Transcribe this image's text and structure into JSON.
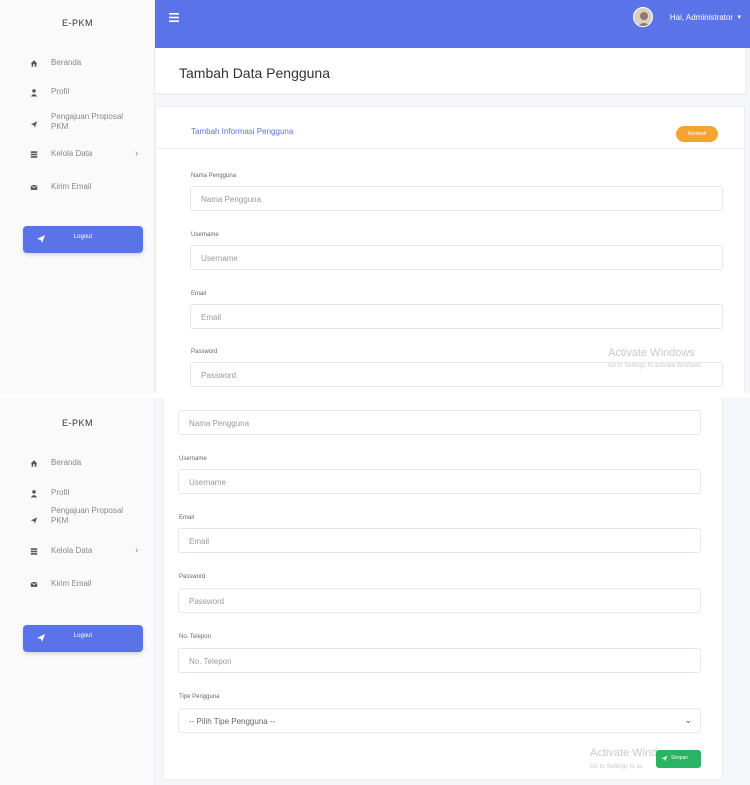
{
  "sidebar": {
    "brand": "E-PKM",
    "items": [
      {
        "label": "Beranda",
        "icon": "home-icon"
      },
      {
        "label": "Profil",
        "icon": "user-icon"
      },
      {
        "label": "Pengajuan Proposal PKM",
        "icon": "send-icon"
      },
      {
        "label": "Kelola Data",
        "icon": "list-icon",
        "has_submenu": true
      },
      {
        "label": "Kirim Email",
        "icon": "envelope-icon"
      }
    ],
    "logout_label": "Logout"
  },
  "topbar": {
    "user_label": "Hai, Administrator",
    "caret": "▾",
    "color": "#5b73e8"
  },
  "page": {
    "title": "Tambah Data Pengguna"
  },
  "form": {
    "heading": "Tambah Informasi Pengguna",
    "back_label": "Kembali",
    "submit_label": "Simpan",
    "fields": {
      "nama": {
        "label": "Nama Pengguna",
        "placeholder": "Nama Pengguna"
      },
      "username": {
        "label": "Username",
        "placeholder": "Username"
      },
      "email": {
        "label": "Email",
        "placeholder": "Email"
      },
      "password": {
        "label": "Password",
        "placeholder": "Password"
      },
      "telepon": {
        "label": "No. Telepon",
        "placeholder": "No. Telepon"
      },
      "tipe": {
        "label": "Tipe Pengguna",
        "selected": "-- Pilih Tipe Pengguna --"
      }
    }
  },
  "watermark": {
    "line1": "Activate Windows",
    "line2": "Go to Settings to activate Windows.",
    "line1_cropped": "Activate Wind",
    "line2_cropped": "Go to Settings to ac"
  },
  "colors": {
    "primary": "#5b73e8",
    "warning": "#f6a430",
    "success": "#28b463"
  }
}
